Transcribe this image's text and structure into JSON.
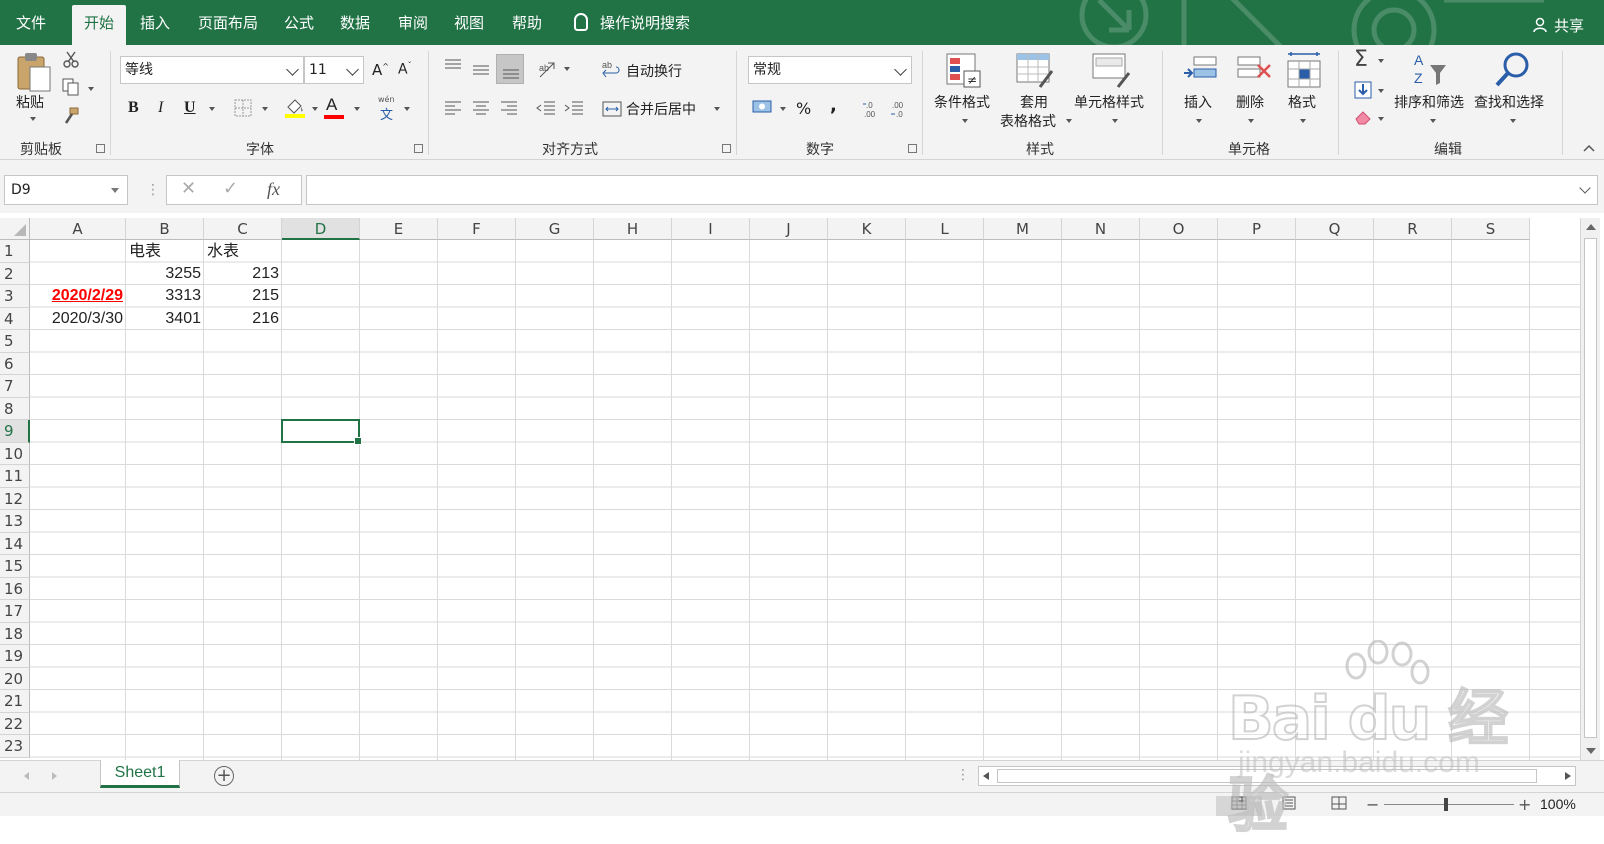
{
  "tabs": [
    {
      "id": "file",
      "label": "文件"
    },
    {
      "id": "home",
      "label": "开始",
      "active": true
    },
    {
      "id": "insert",
      "label": "插入"
    },
    {
      "id": "layout",
      "label": "页面布局"
    },
    {
      "id": "formula",
      "label": "公式"
    },
    {
      "id": "data",
      "label": "数据"
    },
    {
      "id": "review",
      "label": "审阅"
    },
    {
      "id": "view",
      "label": "视图"
    },
    {
      "id": "help",
      "label": "帮助"
    }
  ],
  "tell_me": "操作说明搜索",
  "share": "共享",
  "ribbon": {
    "clipboard": {
      "paste": "粘贴",
      "label": "剪贴板"
    },
    "font": {
      "name": "等线",
      "size": "11",
      "label": "字体",
      "bold": "B",
      "italic": "I",
      "underline": "U",
      "fontcolor": "A",
      "phonetic_top": "wén",
      "phonetic_bottom": "文"
    },
    "alignment": {
      "wrap": "自动换行",
      "merge": "合并后居中",
      "label": "对齐方式"
    },
    "number": {
      "format": "常规",
      "percent": "%",
      "comma": ",",
      "label": "数字"
    },
    "styles": {
      "conditional": "条件格式",
      "table_format_1": "套用",
      "table_format_2": "表格格式",
      "cell_styles": "单元格样式",
      "label": "样式"
    },
    "cells": {
      "insert": "插入",
      "delete": "删除",
      "format": "格式",
      "label": "单元格"
    },
    "editing": {
      "sort_filter": "排序和筛选",
      "find_select": "查找和选择",
      "label": "编辑",
      "sigma": "Σ"
    }
  },
  "formula_bar": {
    "name_box": "D9",
    "fx": "fx",
    "formula": ""
  },
  "columns": [
    "A",
    "B",
    "C",
    "D",
    "E",
    "F",
    "G",
    "H",
    "I",
    "J",
    "K",
    "L",
    "M",
    "N",
    "O",
    "P",
    "Q",
    "R",
    "S"
  ],
  "selected_column": "D",
  "selected_row": 9,
  "rows": [
    1,
    2,
    3,
    4,
    5,
    6,
    7,
    8,
    9,
    10,
    11,
    12,
    13,
    14,
    15,
    16,
    17,
    18,
    19,
    20,
    21,
    22,
    23
  ],
  "cells": {
    "B1": "电表",
    "C1": "水表",
    "B2": "3255",
    "C2": "213",
    "A3": "2020/2/29",
    "B3": "3313",
    "C3": "215",
    "A4": "2020/3/30",
    "B4": "3401",
    "C4": "216"
  },
  "sheet_tab": "Sheet1",
  "zoom": "100%",
  "watermark": {
    "main": "Bai du 经验",
    "sub": "jingyan.baidu.com"
  }
}
